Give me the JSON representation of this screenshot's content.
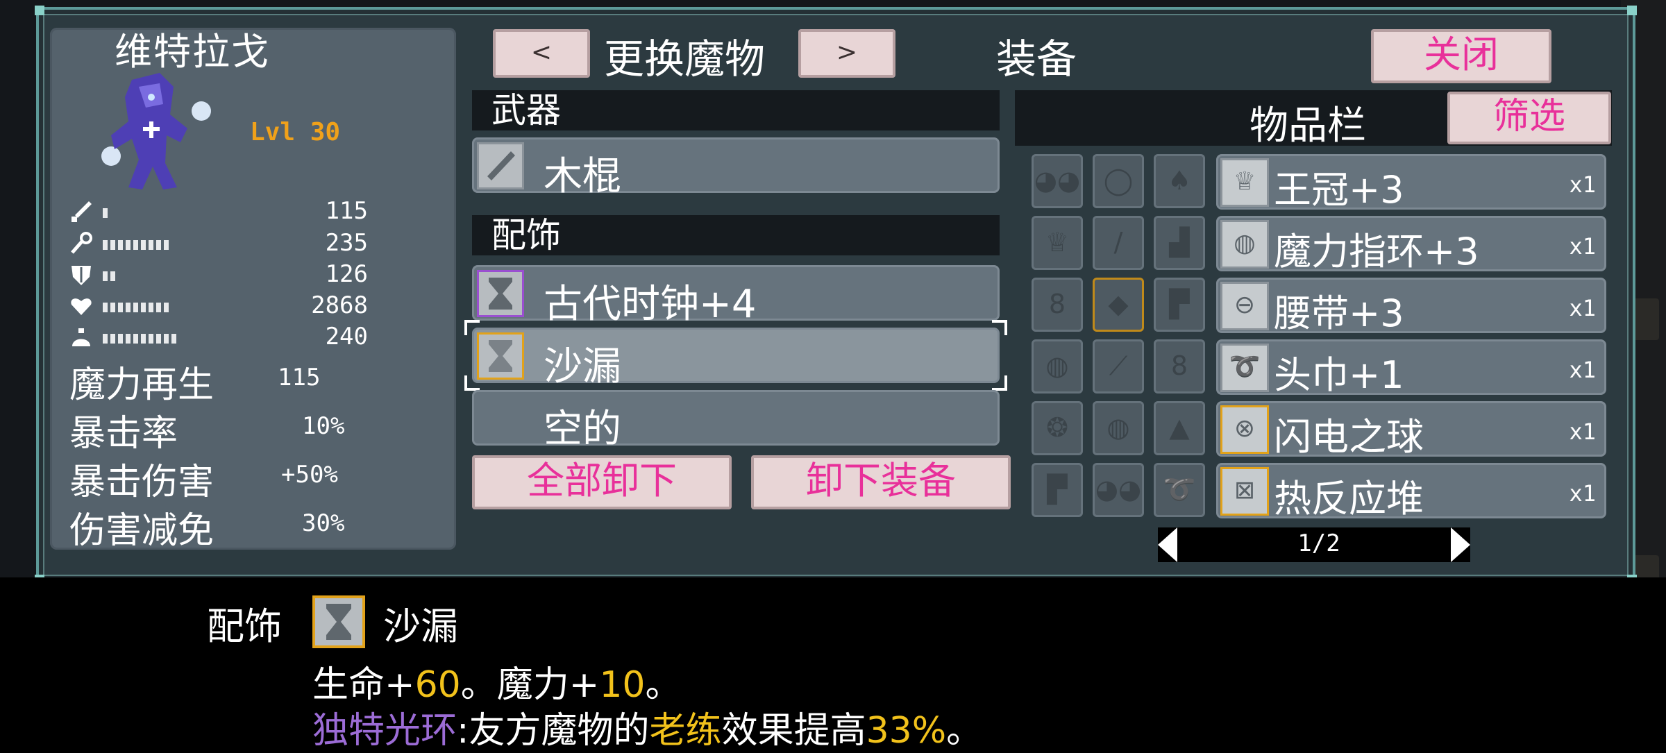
{
  "monster": {
    "name": "维特拉戈",
    "level": "Lvl 30"
  },
  "stats": [
    {
      "icon": "sword-icon",
      "bars": 1,
      "value": "115"
    },
    {
      "icon": "wand-icon",
      "bars": 9,
      "value": "235"
    },
    {
      "icon": "shield-icon",
      "bars": 2,
      "value": "126"
    },
    {
      "icon": "heart-icon",
      "bars": 9,
      "value": "2868"
    },
    {
      "icon": "mana-potion-icon",
      "bars": 10,
      "value": "240"
    }
  ],
  "attributes": [
    {
      "label": "魔力再生",
      "value": "115"
    },
    {
      "label": "暴击率",
      "value": "10%"
    },
    {
      "label": "暴击伤害",
      "value": "+50%"
    },
    {
      "label": "伤害减免",
      "value": "30%"
    }
  ],
  "header": {
    "prev": "<",
    "change": "更换魔物",
    "next": ">",
    "equipment": "装备",
    "close": "关闭"
  },
  "sections": {
    "weapon": "武器",
    "accessory": "配饰"
  },
  "weapon_slot": {
    "name": "木棍",
    "icon": "stick-icon"
  },
  "accessory_slots": [
    {
      "name": "古代时钟+4",
      "icon": "hourglass-icon"
    },
    {
      "name": "沙漏",
      "icon": "hourglass-icon"
    },
    {
      "name": "空的",
      "icon": ""
    }
  ],
  "actions": {
    "unequip_all": "全部卸下",
    "unequip": "卸下装备"
  },
  "inventory": {
    "title": "物品栏",
    "filter": "筛选",
    "grid_icons": [
      [
        "mask-icon",
        "ring-icon",
        "claw-icon"
      ],
      [
        "crown-icon",
        "feather-icon",
        "boot-icon"
      ],
      [
        "amulet-icon",
        "gem-icon",
        "boot-icon"
      ],
      [
        "ring-icon",
        "feather-icon",
        "amulet-icon"
      ],
      [
        "orb-icon",
        "ring-icon",
        "hat-icon"
      ],
      [
        "boot-icon",
        "mask-icon",
        "bandana-icon"
      ]
    ],
    "items": [
      {
        "name": "王冠+3",
        "qty": "x1",
        "icon": "crown-icon"
      },
      {
        "name": "魔力指环+3",
        "qty": "x1",
        "icon": "ring-icon"
      },
      {
        "name": "腰带+3",
        "qty": "x1",
        "icon": "belt-icon"
      },
      {
        "name": "头巾+1",
        "qty": "x1",
        "icon": "bandana-icon"
      },
      {
        "name": "闪电之球",
        "qty": "x1",
        "icon": "lightning-orb-icon"
      },
      {
        "name": "热反应堆",
        "qty": "x1",
        "icon": "reactor-icon"
      }
    ],
    "page": "1/2"
  },
  "tooltip": {
    "category": "配饰",
    "name": "沙漏",
    "line1": {
      "a": "生命+",
      "b": "60",
      "c": "。魔力+",
      "d": "10",
      "e": "。"
    },
    "line2": {
      "a": "独特光环",
      "b": ":友方魔物的",
      "c": "老练",
      "d": "效果提高",
      "e": "33%",
      "f": "。"
    }
  },
  "colors": {
    "accent_pink": "#e8309a",
    "gold": "#f2c21b",
    "purple": "#9c6cd6",
    "level_orange": "#f0a11a"
  }
}
